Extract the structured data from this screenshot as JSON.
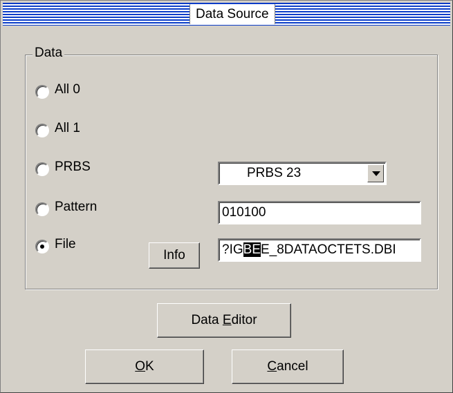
{
  "window": {
    "title": "Data Source"
  },
  "group": {
    "label": "Data"
  },
  "radios": [
    {
      "label": "All 0",
      "checked": false
    },
    {
      "label": "All 1",
      "checked": false
    },
    {
      "label": "PRBS",
      "checked": false
    },
    {
      "label": "Pattern",
      "checked": false
    },
    {
      "label": "File",
      "checked": true
    }
  ],
  "prbs_select": {
    "value": "PRBS 23"
  },
  "pattern_input": {
    "value": "010100"
  },
  "file_input": {
    "before": "?IG",
    "selected": "BE",
    "after": "E_8DATAOCTETS.DBI"
  },
  "buttons": {
    "info": "Info",
    "data_editor_pre": "Data ",
    "data_editor_accel": "E",
    "data_editor_post": "ditor",
    "ok_accel": "O",
    "ok_post": "K",
    "cancel_accel": "C",
    "cancel_post": "ancel"
  }
}
